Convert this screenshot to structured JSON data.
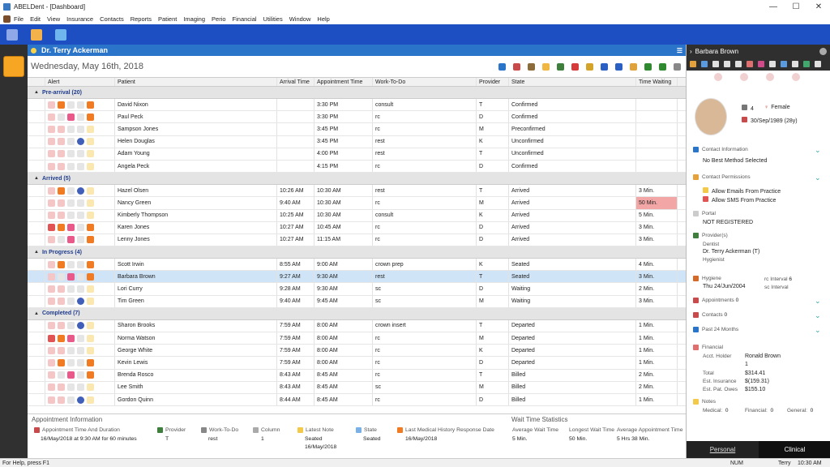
{
  "app": {
    "title": "ABELDent - [Dashboard]"
  },
  "menu": [
    "File",
    "Edit",
    "View",
    "Insurance",
    "Contacts",
    "Reports",
    "Patient",
    "Imaging",
    "Perio",
    "Financial",
    "Utilities",
    "Window",
    "Help"
  ],
  "dashboard": {
    "doctor": "Dr. Terry Ackerman",
    "date": "Wednesday, May 16th, 2018",
    "columns": [
      "Alert",
      "Patient",
      "Arrival Time",
      "Appointment Time",
      "Work-To-Do",
      "Provider",
      "State",
      "Time Waiting"
    ],
    "groups": [
      {
        "label": "Pre-arrival (20)",
        "rows": [
          {
            "patient": "David Nixon",
            "arrival": "",
            "appt": "3:30 PM",
            "work": "consult",
            "prov": "T",
            "state": "Confirmed",
            "wait": ""
          },
          {
            "patient": "Paul Peck",
            "arrival": "",
            "appt": "3:30 PM",
            "work": "rc",
            "prov": "D",
            "state": "Confirmed",
            "wait": ""
          },
          {
            "patient": "Sampson Jones",
            "arrival": "",
            "appt": "3:45 PM",
            "work": "rc",
            "prov": "M",
            "state": "Preconfirmed",
            "wait": ""
          },
          {
            "patient": "Helen Douglas",
            "arrival": "",
            "appt": "3:45 PM",
            "work": "rest",
            "prov": "K",
            "state": "Unconfirmed",
            "wait": ""
          },
          {
            "patient": "Adam Young",
            "arrival": "",
            "appt": "4:00 PM",
            "work": "rest",
            "prov": "T",
            "state": "Unconfirmed",
            "wait": ""
          },
          {
            "patient": "Angela Peck",
            "arrival": "",
            "appt": "4:15 PM",
            "work": "rc",
            "prov": "D",
            "state": "Confirmed",
            "wait": ""
          }
        ]
      },
      {
        "label": "Arrived (5)",
        "rows": [
          {
            "patient": "Hazel Olsen",
            "arrival": "10:26 AM",
            "appt": "10:30 AM",
            "work": "rest",
            "prov": "T",
            "state": "Arrived",
            "wait": "3 Min."
          },
          {
            "patient": "Nancy Green",
            "arrival": "9:40 AM",
            "appt": "10:30 AM",
            "work": "rc",
            "prov": "M",
            "state": "Arrived",
            "wait": "50 Min."
          },
          {
            "patient": "Kimberly Thompson",
            "arrival": "10:25 AM",
            "appt": "10:30 AM",
            "work": "consult",
            "prov": "K",
            "state": "Arrived",
            "wait": "5 Min."
          },
          {
            "patient": "Karen Jones",
            "arrival": "10:27 AM",
            "appt": "10:45 AM",
            "work": "rc",
            "prov": "D",
            "state": "Arrived",
            "wait": "3 Min."
          },
          {
            "patient": "Lenny Jones",
            "arrival": "10:27 AM",
            "appt": "11:15 AM",
            "work": "rc",
            "prov": "D",
            "state": "Arrived",
            "wait": "3 Min."
          }
        ]
      },
      {
        "label": "In Progress (4)",
        "rows": [
          {
            "patient": "Scott Irwin",
            "arrival": "8:55 AM",
            "appt": "9:00 AM",
            "work": "crown prep",
            "prov": "K",
            "state": "Seated",
            "wait": "4 Min."
          },
          {
            "patient": "Barbara Brown",
            "arrival": "9:27 AM",
            "appt": "9:30 AM",
            "work": "rest",
            "prov": "T",
            "state": "Seated",
            "wait": "3 Min."
          },
          {
            "patient": "Lori Curry",
            "arrival": "9:28 AM",
            "appt": "9:30 AM",
            "work": "sc",
            "prov": "D",
            "state": "Waiting",
            "wait": "2 Min."
          },
          {
            "patient": "Tim Green",
            "arrival": "9:40 AM",
            "appt": "9:45 AM",
            "work": "sc",
            "prov": "M",
            "state": "Waiting",
            "wait": "3 Min."
          }
        ]
      },
      {
        "label": "Completed (7)",
        "rows": [
          {
            "patient": "Sharon Brooks",
            "arrival": "7:59 AM",
            "appt": "8:00 AM",
            "work": "crown insert",
            "prov": "T",
            "state": "Departed",
            "wait": "1 Min."
          },
          {
            "patient": "Norma Watson",
            "arrival": "7:59 AM",
            "appt": "8:00 AM",
            "work": "rc",
            "prov": "M",
            "state": "Departed",
            "wait": "1 Min."
          },
          {
            "patient": "George White",
            "arrival": "7:59 AM",
            "appt": "8:00 AM",
            "work": "rc",
            "prov": "K",
            "state": "Departed",
            "wait": "1 Min."
          },
          {
            "patient": "Kevin Lewis",
            "arrival": "7:59 AM",
            "appt": "8:00 AM",
            "work": "rc",
            "prov": "D",
            "state": "Departed",
            "wait": "1 Min."
          },
          {
            "patient": "Brenda Rosco",
            "arrival": "8:43 AM",
            "appt": "8:45 AM",
            "work": "rc",
            "prov": "T",
            "state": "Billed",
            "wait": "2 Min."
          },
          {
            "patient": "Lee Smith",
            "arrival": "8:43 AM",
            "appt": "8:45 AM",
            "work": "sc",
            "prov": "M",
            "state": "Billed",
            "wait": "2 Min."
          },
          {
            "patient": "Gordon Quinn",
            "arrival": "8:44 AM",
            "appt": "8:45 AM",
            "work": "rc",
            "prov": "D",
            "state": "Billed",
            "wait": "1 Min."
          }
        ]
      }
    ]
  },
  "appointment_info": {
    "title": "Appointment Information",
    "time_label": "Appointment Time And Duration",
    "time_value": "16/May/2018 at 9:30 AM for 60 minutes",
    "provider_label": "Provider",
    "provider_value": "T",
    "work_label": "Work-To-Do",
    "work_value": "rest",
    "column_label": "Column",
    "column_value": "1",
    "note_label": "Latest Note",
    "note_value1": "Seated",
    "note_value2": "16/May/2018",
    "state_label": "State",
    "state_value": "Seated",
    "medhist_label": "Last Medical History Response Date",
    "medhist_value": "16/May/2018"
  },
  "wait_stats": {
    "title": "Wait Time Statistics",
    "avg_label": "Average Wait Time",
    "avg_value": "5 Min.",
    "longest_label": "Longest Wait Time",
    "longest_value": "50 Min.",
    "avgappt_label": "Average Appointment Time",
    "avgappt_value": "5 Hrs 38 Min."
  },
  "patient_panel": {
    "name": "Barbara Brown",
    "chart_count": "4",
    "gender": "Female",
    "dob": "30/Sep/1989 (28y)",
    "contact_label": "Contact Information",
    "contact_value": "No Best Method Selected",
    "perm_label": "Contact Permissions",
    "perm_email": "Allow Emails From Practice",
    "perm_sms": "Allow SMS From Practice",
    "portal_label": "Portal",
    "portal_value": "NOT REGISTERED",
    "providers_label": "Provider(s)",
    "dentist_label": "Dentist",
    "dentist_value": "Dr. Terry Ackerman (T)",
    "hygienist_label": "Hygienist",
    "hygiene_label": "Hygiene",
    "hygiene_date": "Thu 24/Jun/2004",
    "rc_interval_label": "rc Interval",
    "rc_interval_value": "6",
    "sc_interval_label": "sc Interval",
    "appointments_label": "Appointments",
    "appointments_value": "0",
    "contacts_label": "Contacts",
    "contacts_value": "0",
    "past24_label": "Past 24 Months",
    "financial_label": "Financial",
    "acct_holder_label": "Acct. Holder",
    "acct_holder_value": "Ronald Brown",
    "acct_num": "1",
    "total_label": "Total",
    "total_value": "$314.41",
    "est_ins_label": "Est. Insurance",
    "est_ins_value": "$(159.31)",
    "est_pat_label": "Est. Pat. Owes",
    "est_pat_value": "$155.10",
    "notes_label": "Notes",
    "medical_label": "Medical:",
    "medical_value": "0",
    "financial_notes_label": "Financial:",
    "financial_notes_value": "0",
    "general_label": "General:",
    "general_value": "0",
    "tab_personal": "Personal",
    "tab_clinical": "Clinical"
  },
  "status": {
    "help": "For Help, press F1",
    "num": "NUM",
    "user": "Terry",
    "time": "10:30 AM"
  },
  "colors": {
    "header_blue": "#1d4fc3",
    "group_text": "#1f3c8c",
    "selected_row": "#cfe4f6",
    "long_wait": "#f3a6a6"
  }
}
